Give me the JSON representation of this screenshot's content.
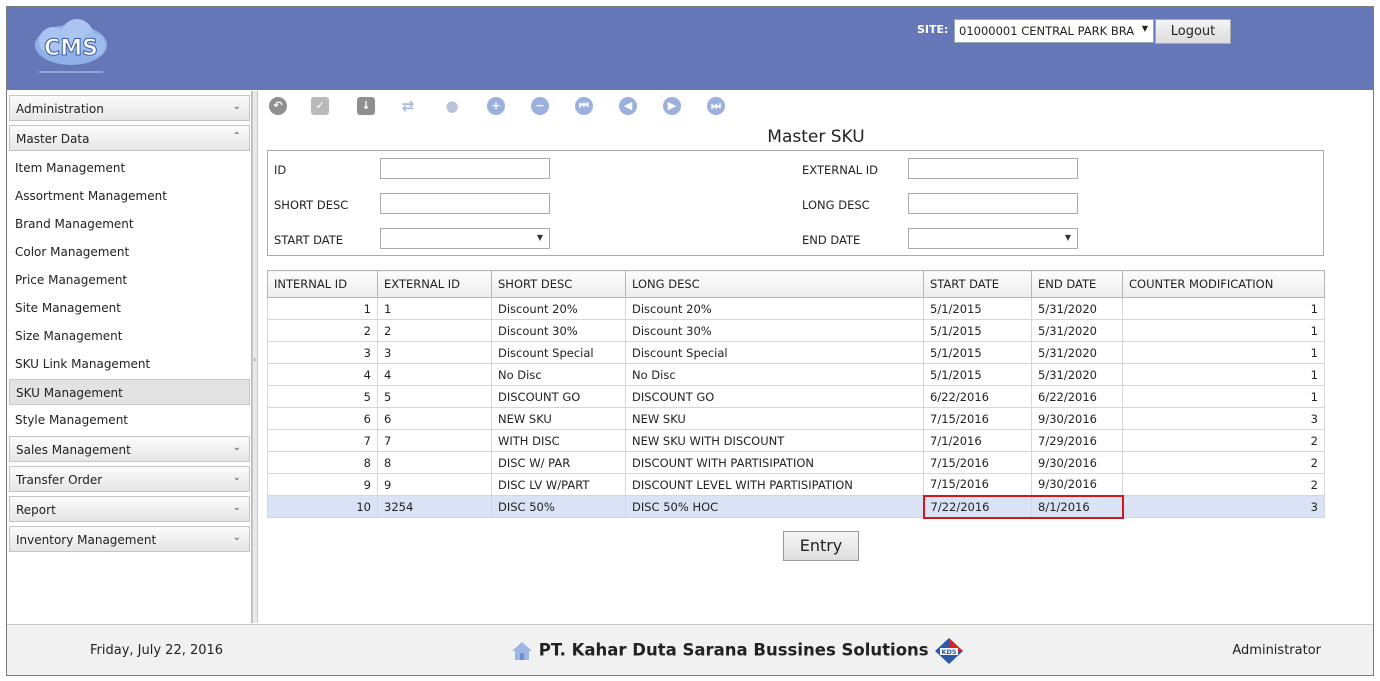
{
  "header": {
    "logo_text": "CMS",
    "site_label": "SITE:",
    "site_value": "01000001 CENTRAL PARK BRA",
    "logout_label": "Logout"
  },
  "sidebar": {
    "groups_top": [
      {
        "label": "Administration",
        "state": "collapsed"
      },
      {
        "label": "Master Data",
        "state": "expanded"
      }
    ],
    "master_items": [
      {
        "label": "Item Management"
      },
      {
        "label": "Assortment Management"
      },
      {
        "label": "Brand Management"
      },
      {
        "label": "Color Management"
      },
      {
        "label": "Price Management"
      },
      {
        "label": "Site Management"
      },
      {
        "label": "Size Management"
      },
      {
        "label": "SKU Link Management"
      },
      {
        "label": "SKU Management",
        "active": true
      },
      {
        "label": "Style Management"
      }
    ],
    "groups_bottom": [
      {
        "label": "Sales Management"
      },
      {
        "label": "Transfer Order"
      },
      {
        "label": "Report"
      },
      {
        "label": "Inventory Management"
      }
    ]
  },
  "toolbar": {
    "icons": [
      "undo-icon",
      "approve-doc-icon",
      "download-icon",
      "refresh-icon",
      "user-icon",
      "add-icon",
      "remove-icon",
      "first-page-icon",
      "previous-page-icon",
      "next-page-icon",
      "last-page-icon"
    ]
  },
  "page": {
    "title": "Master SKU"
  },
  "filters": {
    "id_label": "ID",
    "external_id_label": "EXTERNAL ID",
    "short_desc_label": "SHORT DESC",
    "long_desc_label": "LONG DESC",
    "start_date_label": "START DATE",
    "end_date_label": "END DATE"
  },
  "table": {
    "columns": [
      "INTERNAL ID",
      "EXTERNAL ID",
      "SHORT DESC",
      "LONG DESC",
      "START DATE",
      "END DATE",
      "COUNTER MODIFICATION"
    ],
    "rows": [
      [
        "1",
        "1",
        "Discount 20%",
        "Discount 20%",
        "5/1/2015",
        "5/31/2020",
        "1"
      ],
      [
        "2",
        "2",
        "Discount 30%",
        "Discount 30%",
        "5/1/2015",
        "5/31/2020",
        "1"
      ],
      [
        "3",
        "3",
        "Discount Special",
        "Discount Special",
        "5/1/2015",
        "5/31/2020",
        "1"
      ],
      [
        "4",
        "4",
        "No Disc",
        "No Disc",
        "5/1/2015",
        "5/31/2020",
        "1"
      ],
      [
        "5",
        "5",
        "DISCOUNT GO",
        "DISCOUNT GO",
        "6/22/2016",
        "6/22/2016",
        "1"
      ],
      [
        "6",
        "6",
        "NEW SKU",
        "NEW SKU",
        "7/15/2016",
        "9/30/2016",
        "3"
      ],
      [
        "7",
        "7",
        "WITH DISC",
        "NEW SKU WITH DISCOUNT",
        "7/1/2016",
        "7/29/2016",
        "2"
      ],
      [
        "8",
        "8",
        "DISC W/ PAR",
        "DISCOUNT WITH PARTISIPATION",
        "7/15/2016",
        "9/30/2016",
        "2"
      ],
      [
        "9",
        "9",
        "DISC LV W/PART",
        "DISCOUNT LEVEL WITH PARTISIPATION",
        "7/15/2016",
        "9/30/2016",
        "2"
      ],
      [
        "10",
        "3254",
        "DISC 50%",
        "DISC 50% HOC",
        "7/22/2016",
        "8/1/2016",
        "3"
      ]
    ],
    "selected_row": 9
  },
  "actions": {
    "entry_label": "Entry"
  },
  "footer": {
    "date": "Friday, July 22, 2016",
    "company": "PT. Kahar Duta Sarana Bussines Solutions",
    "user": "Administrator"
  },
  "colors": {
    "header_bg": "#6577b7",
    "highlight_border": "#d01818",
    "selected_row": "#dae3f5"
  }
}
